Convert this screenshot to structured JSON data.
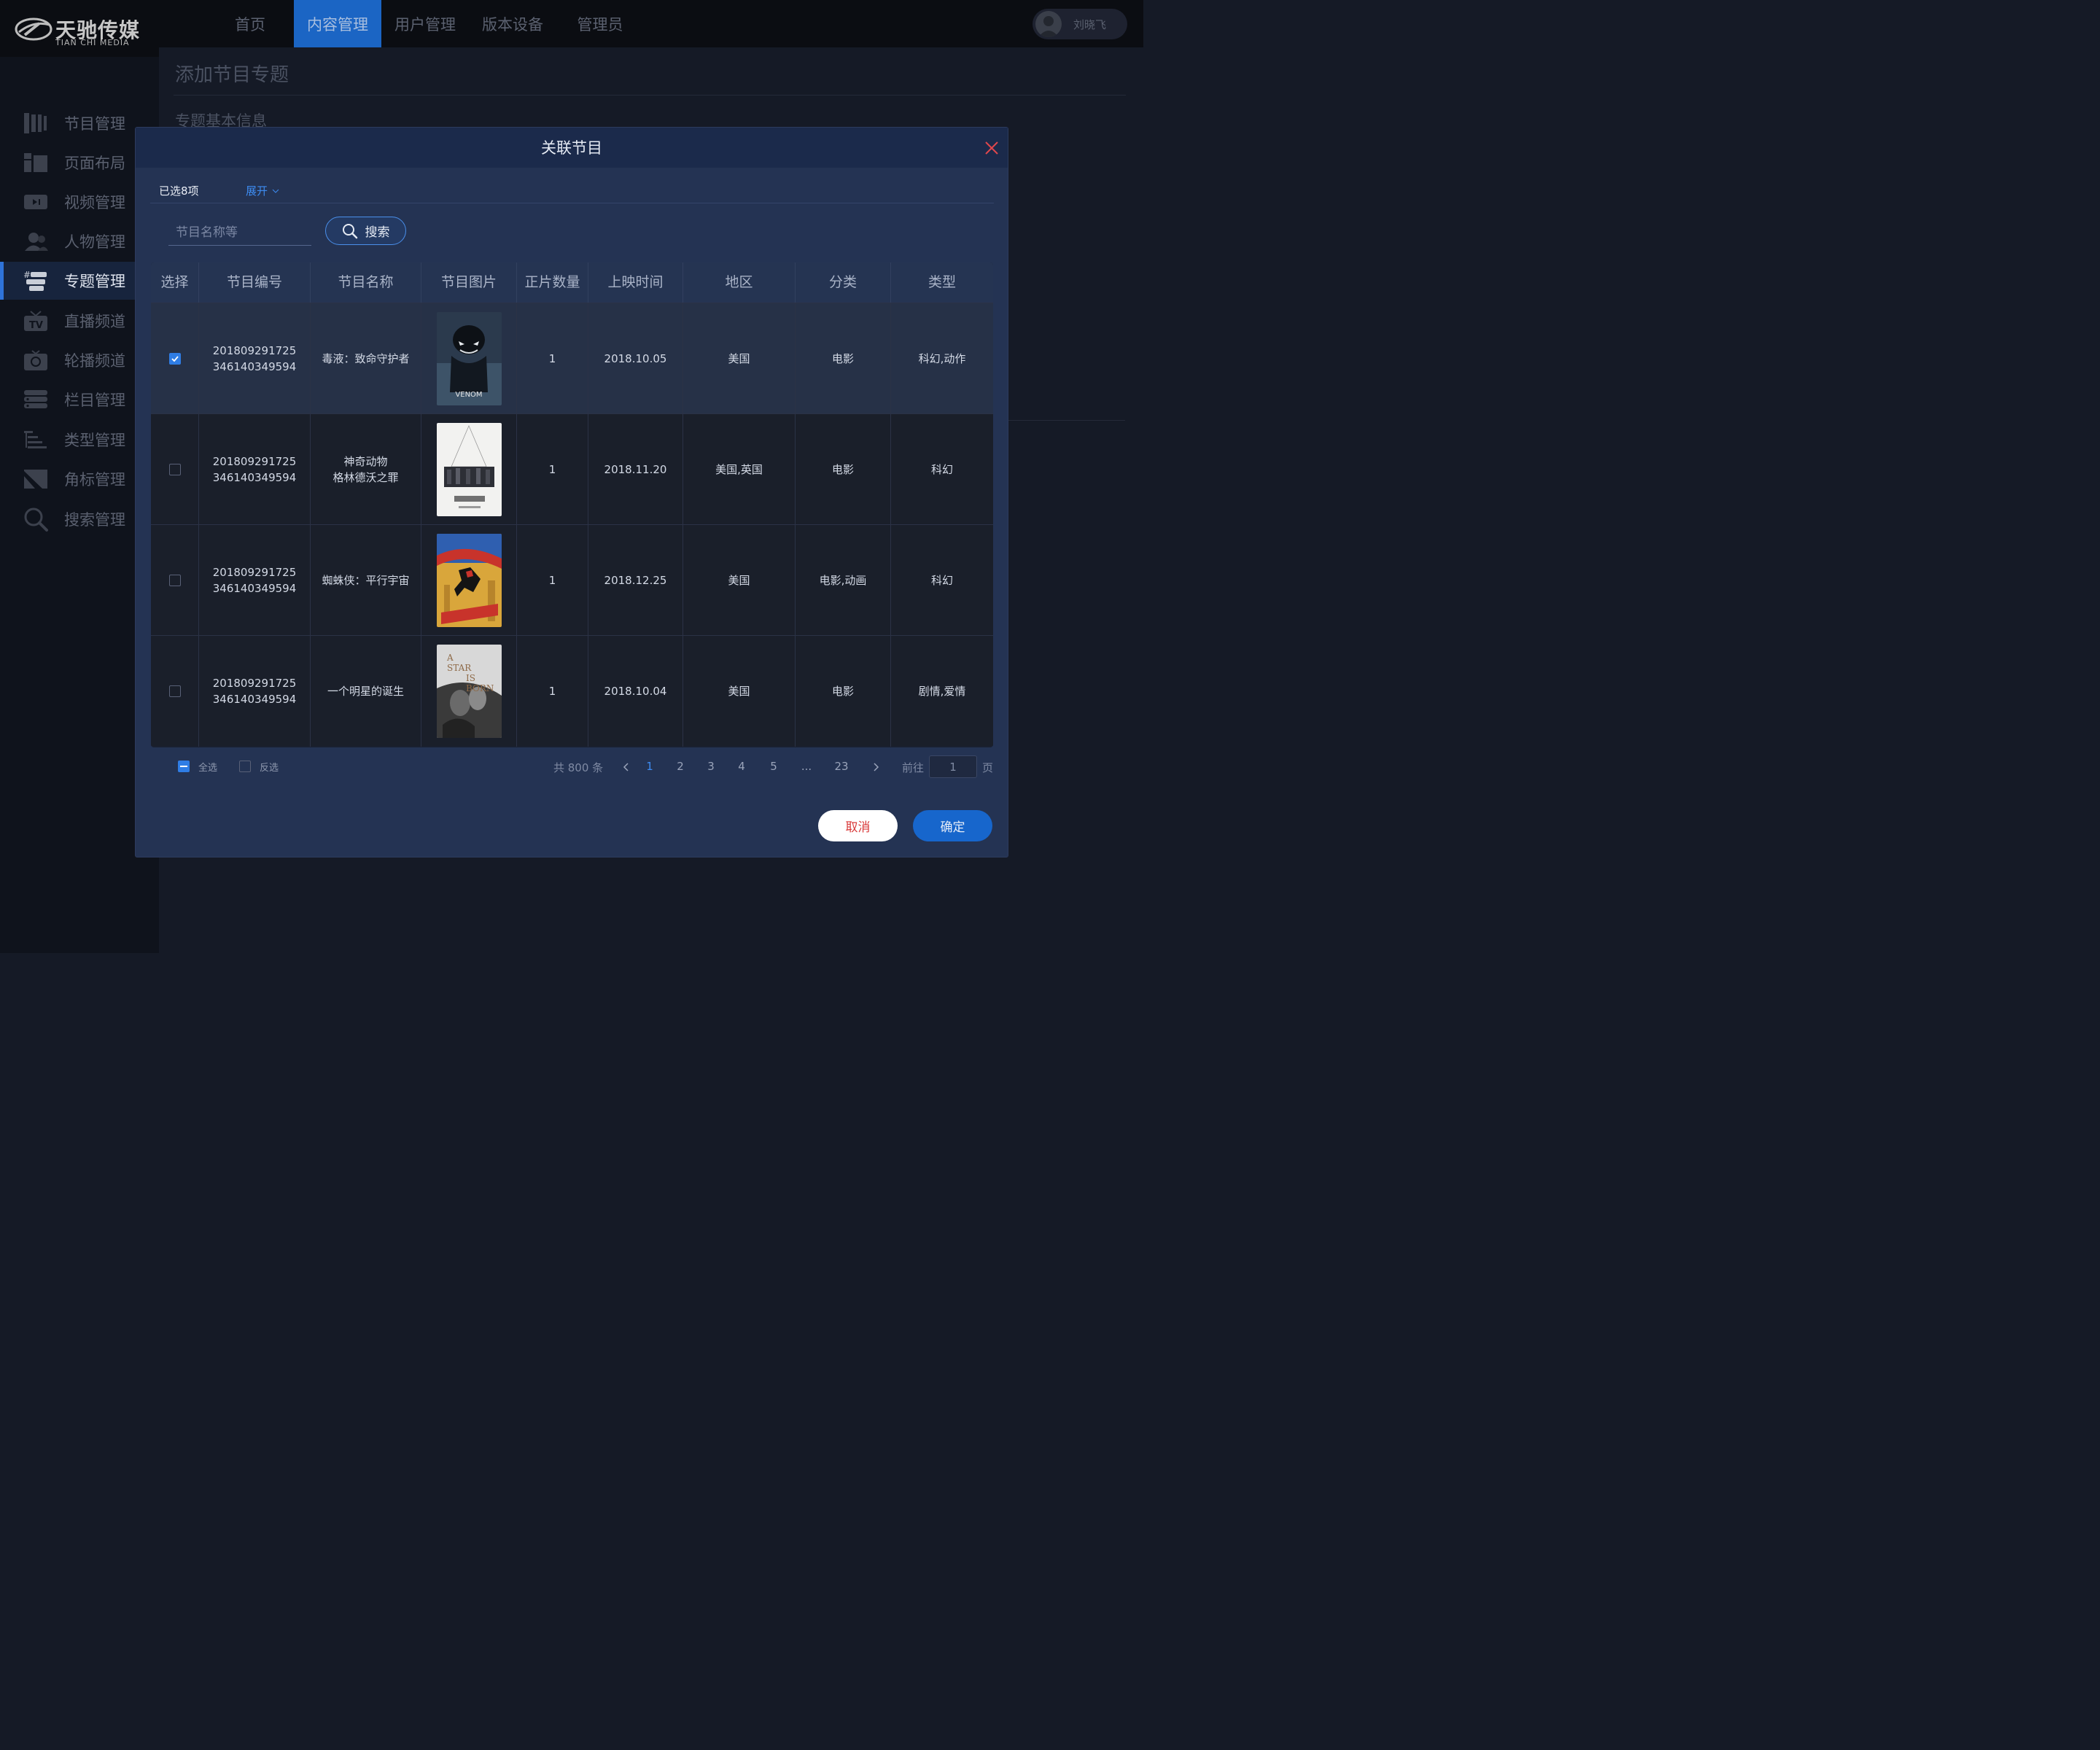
{
  "brand": {
    "name_cn": "天驰传媒",
    "name_en": "TIAN CHI MEDIA"
  },
  "top_nav": [
    {
      "label": "首页",
      "active": false
    },
    {
      "label": "内容管理",
      "active": true
    },
    {
      "label": "用户管理",
      "active": false
    },
    {
      "label": "版本设备",
      "active": false
    },
    {
      "label": "管理员",
      "active": false
    }
  ],
  "user": {
    "name": "刘晓飞"
  },
  "sidebar": {
    "items": [
      {
        "label": "节目管理",
        "icon": "program-icon"
      },
      {
        "label": "页面布局",
        "icon": "layout-icon"
      },
      {
        "label": "视频管理",
        "icon": "video-icon"
      },
      {
        "label": "人物管理",
        "icon": "people-icon"
      },
      {
        "label": "专题管理",
        "icon": "topic-icon",
        "active": true
      },
      {
        "label": "直播频道",
        "icon": "tv-icon"
      },
      {
        "label": "轮播频道",
        "icon": "carousel-icon"
      },
      {
        "label": "栏目管理",
        "icon": "column-icon"
      },
      {
        "label": "类型管理",
        "icon": "type-icon"
      },
      {
        "label": "角标管理",
        "icon": "badge-icon"
      },
      {
        "label": "搜索管理",
        "icon": "search-icon"
      }
    ]
  },
  "page": {
    "title": "添加节目专题",
    "section": "专题基本信息"
  },
  "modal": {
    "title": "关联节目",
    "selected_label": "已选8项",
    "expand_label": "展开",
    "search": {
      "placeholder": "节目名称等",
      "button": "搜索"
    },
    "columns": [
      "选择",
      "节目编号",
      "节目名称",
      "节目图片",
      "正片数量",
      "上映时间",
      "地区",
      "分类",
      "类型"
    ],
    "rows": [
      {
        "checked": true,
        "id_line1": "201809291725",
        "id_line2": "346140349594",
        "name_line1": "毒液：致命守护者",
        "name_line2": "",
        "poster": "venom-poster",
        "episodes": "1",
        "date": "2018.10.05",
        "region": "美国",
        "category": "电影",
        "genre": "科幻,动作"
      },
      {
        "checked": false,
        "id_line1": "201809291725",
        "id_line2": "346140349594",
        "name_line1": "神奇动物",
        "name_line2": "格林德沃之罪",
        "poster": "fantastic-beasts-poster",
        "episodes": "1",
        "date": "2018.11.20",
        "region": "美国,英国",
        "category": "电影",
        "genre": "科幻"
      },
      {
        "checked": false,
        "id_line1": "201809291725",
        "id_line2": "346140349594",
        "name_line1": "蜘蛛侠：平行宇宙",
        "name_line2": "",
        "poster": "spider-verse-poster",
        "episodes": "1",
        "date": "2018.12.25",
        "region": "美国",
        "category": "电影,动画",
        "genre": "科幻"
      },
      {
        "checked": false,
        "id_line1": "201809291725",
        "id_line2": "346140349594",
        "name_line1": "一个明星的诞生",
        "name_line2": "",
        "poster": "a-star-is-born-poster",
        "episodes": "1",
        "date": "2018.10.04",
        "region": "美国",
        "category": "电影",
        "genre": "剧情,爱情"
      }
    ],
    "footer": {
      "select_all": "全选",
      "invert": "反选",
      "total": "共 800 条",
      "pages": [
        "1",
        "2",
        "3",
        "4",
        "5",
        "...",
        "23"
      ],
      "current_page": "1",
      "goto_label": "前往",
      "goto_value": "1",
      "page_suffix": "页"
    },
    "buttons": {
      "cancel": "取消",
      "ok": "确定"
    }
  },
  "colors": {
    "accent": "#1766cc",
    "link": "#3d8bf0",
    "danger": "#d93a3a"
  }
}
